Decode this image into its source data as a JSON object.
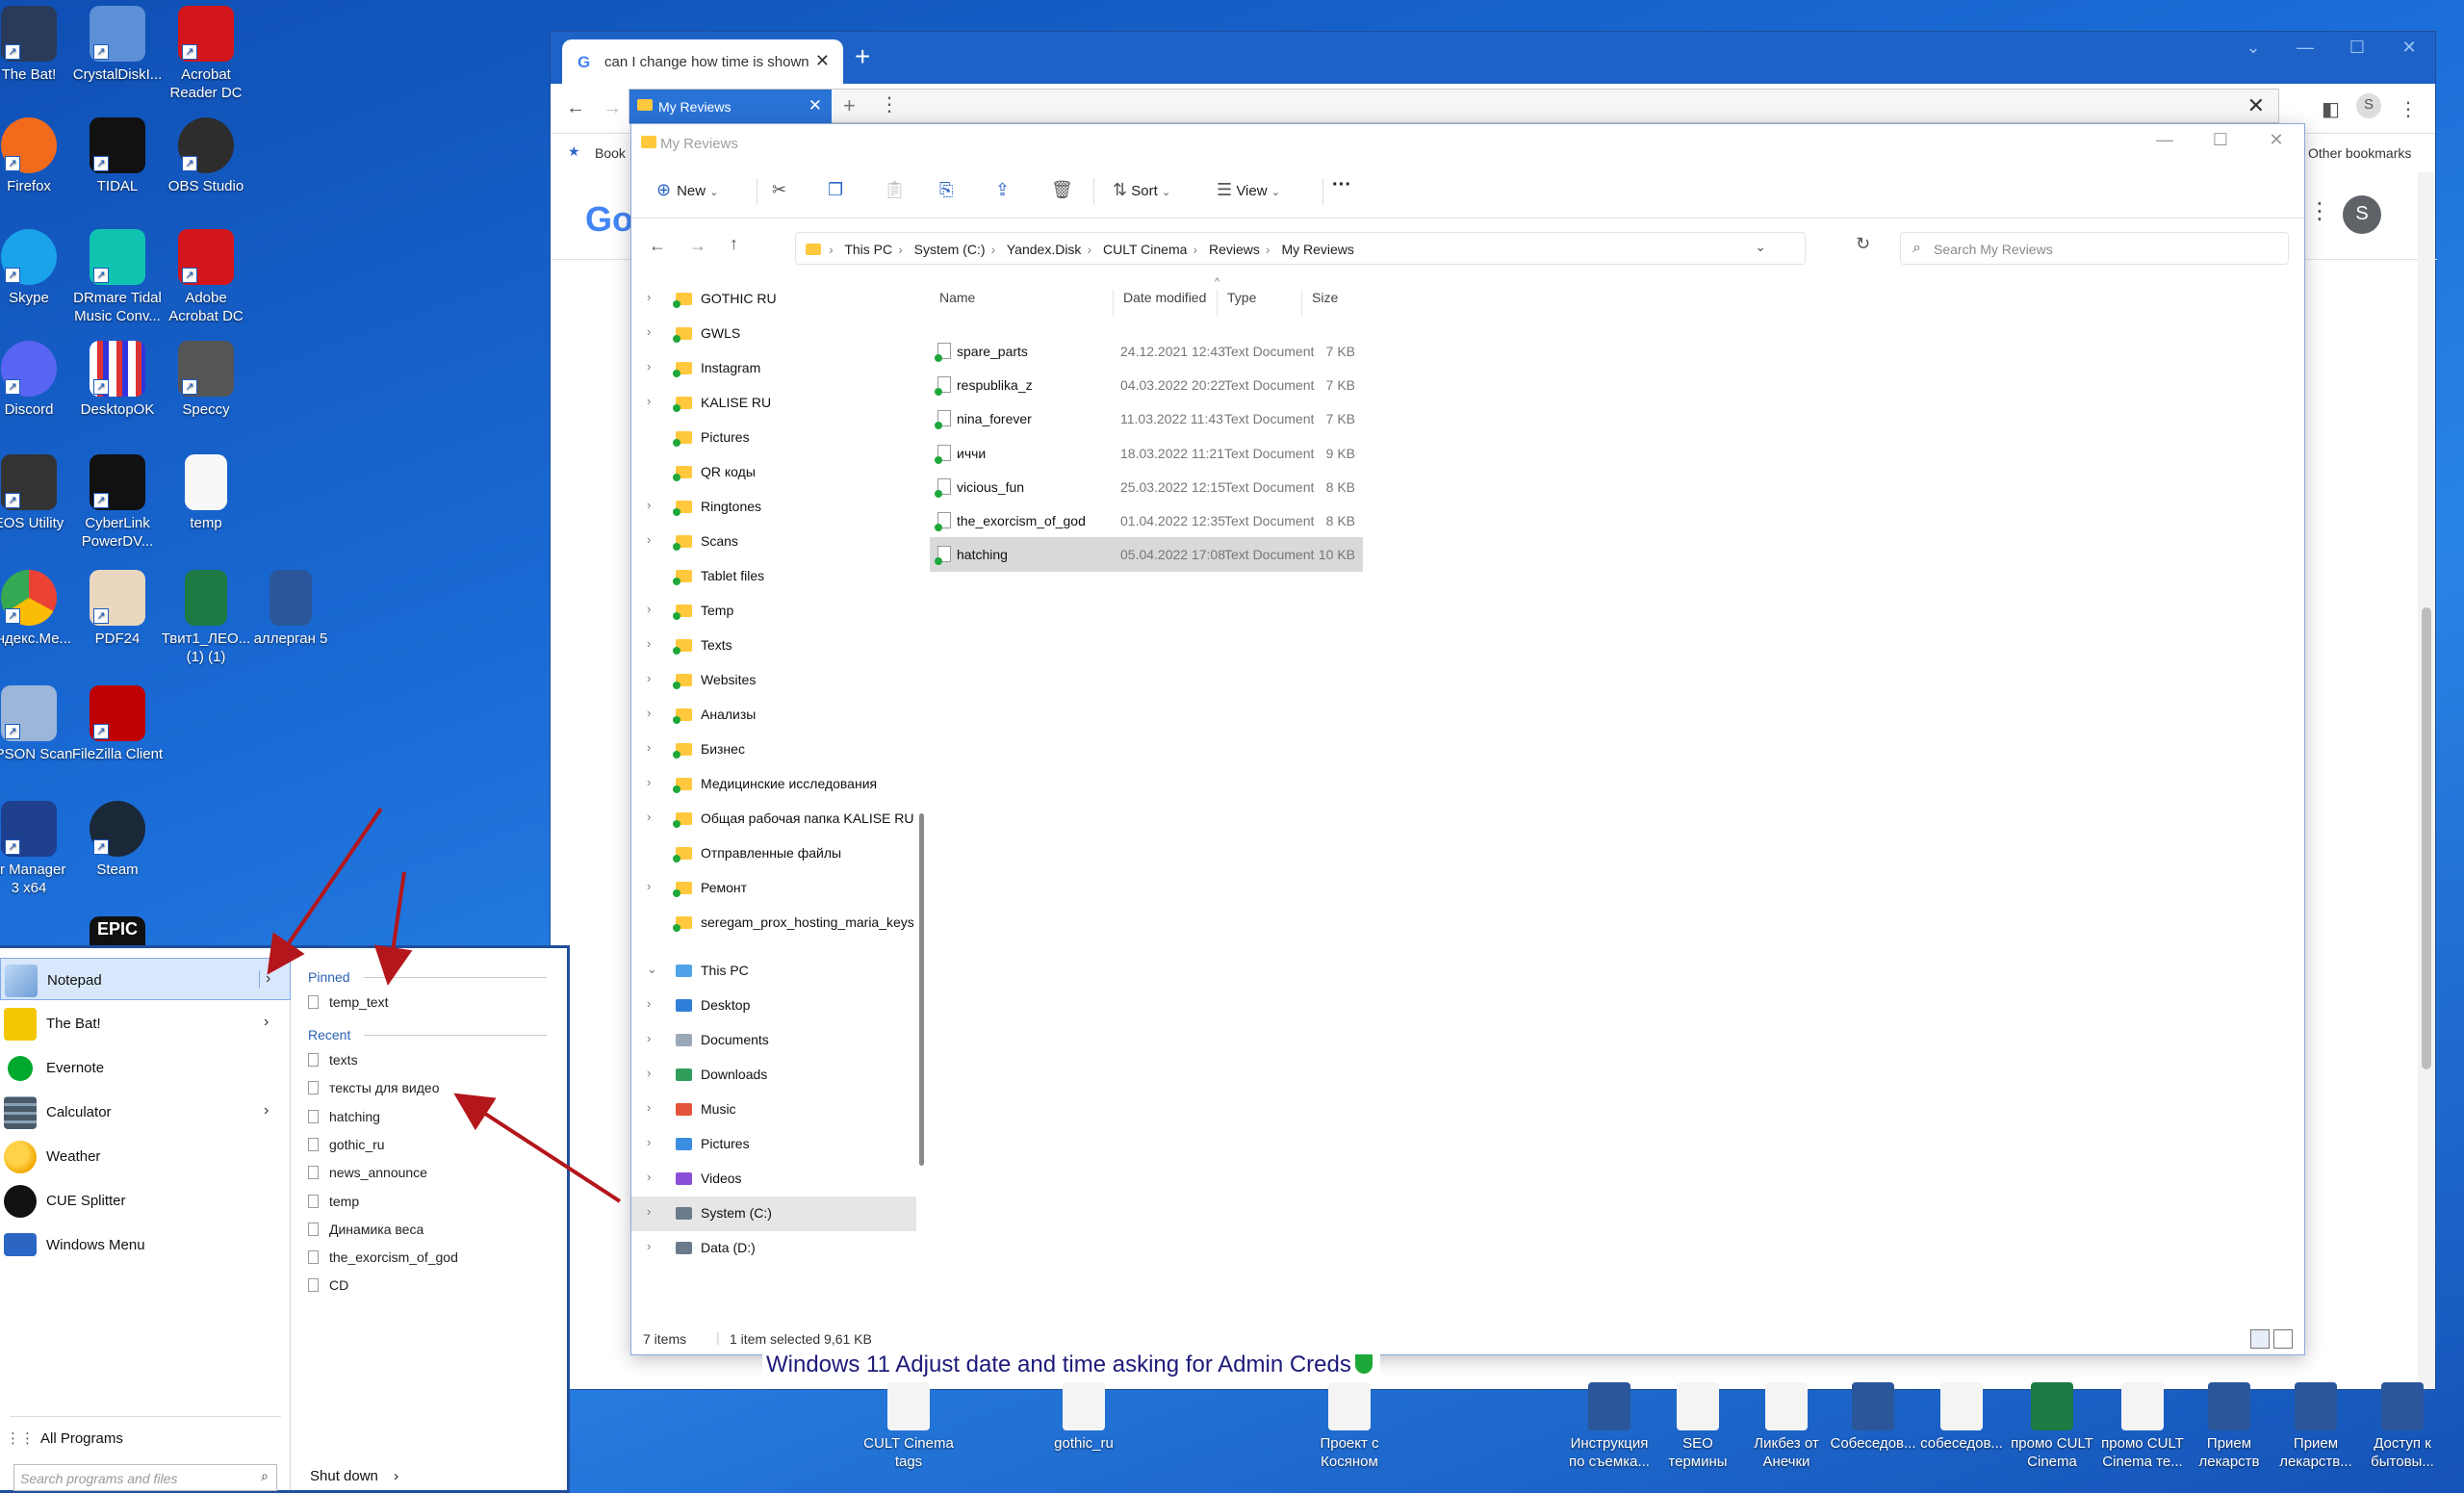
{
  "desktop_icons": [
    {
      "label": "The Bat!"
    },
    {
      "label": "CrystalDiskI..."
    },
    {
      "label": "Acrobat\nReader DC"
    },
    {
      "label": "Firefox"
    },
    {
      "label": "TIDAL"
    },
    {
      "label": "OBS Studio"
    },
    {
      "label": "Skype"
    },
    {
      "label": "DRmare Tidal\nMusic Conv..."
    },
    {
      "label": "Adobe\nAcrobat DC"
    },
    {
      "label": "Discord"
    },
    {
      "label": "DesktopOK"
    },
    {
      "label": "Speccy"
    },
    {
      "label": "EOS Utility"
    },
    {
      "label": "CyberLink\nPowerDV..."
    },
    {
      "label": "temp"
    },
    {
      "label": "Яндекс.Ме..."
    },
    {
      "label": "PDF24"
    },
    {
      "label": "Твит1_ЛЕО...\n(1) (1)"
    },
    {
      "label": "аллерган 5"
    },
    {
      "label": "EPSON Scan"
    },
    {
      "label": "FileZilla Client"
    },
    {
      "label": "ar Manager\n3 x64"
    },
    {
      "label": "Steam"
    },
    {
      "label": "EPIC"
    }
  ],
  "chrome": {
    "tab_title": "can I change how time is shown",
    "tab_close": "✕",
    "new_tab": "+",
    "bookmarks_partial": "Book",
    "other_bookmarks": "Other bookmarks",
    "profile_initial": "S",
    "google_partial": "Go"
  },
  "explorer_tab": {
    "label": "My Reviews",
    "close": "✕",
    "plus": "+"
  },
  "explorer": {
    "title": "My Reviews",
    "toolbar": {
      "new": "New",
      "sort": "Sort",
      "view": "View",
      "more": "···"
    },
    "breadcrumb": [
      "This PC",
      "System (C:)",
      "Yandex.Disk",
      "CULT Cinema",
      "Reviews",
      "My Reviews"
    ],
    "search_placeholder": "Search My Reviews",
    "columns": [
      "Name",
      "Date modified",
      "Type",
      "Size"
    ],
    "files": [
      {
        "name": "spare_parts",
        "date": "24.12.2021 12:43",
        "type": "Text Document",
        "size": "7 KB"
      },
      {
        "name": "respublika_z",
        "date": "04.03.2022 20:22",
        "type": "Text Document",
        "size": "7 KB"
      },
      {
        "name": "nina_forever",
        "date": "11.03.2022 11:43",
        "type": "Text Document",
        "size": "7 KB"
      },
      {
        "name": "иччи",
        "date": "18.03.2022 11:21",
        "type": "Text Document",
        "size": "9 KB"
      },
      {
        "name": "vicious_fun",
        "date": "25.03.2022 12:15",
        "type": "Text Document",
        "size": "8 KB"
      },
      {
        "name": "the_exorcism_of_god",
        "date": "01.04.2022 12:35",
        "type": "Text Document",
        "size": "8 KB"
      },
      {
        "name": "hatching",
        "date": "05.04.2022 17:08",
        "type": "Text Document",
        "size": "10 KB"
      }
    ],
    "nav": [
      {
        "label": "GOTHIC RU"
      },
      {
        "label": "GWLS"
      },
      {
        "label": "Instagram"
      },
      {
        "label": "KALISE RU"
      },
      {
        "label": "Pictures"
      },
      {
        "label": "QR коды"
      },
      {
        "label": "Ringtones"
      },
      {
        "label": "Scans"
      },
      {
        "label": "Tablet files"
      },
      {
        "label": "Temp"
      },
      {
        "label": "Texts"
      },
      {
        "label": "Websites"
      },
      {
        "label": "Анализы"
      },
      {
        "label": "Бизнес"
      },
      {
        "label": "Медицинские исследования"
      },
      {
        "label": "Общая рабочая папка KALISE RU"
      },
      {
        "label": "Отправленные файлы"
      },
      {
        "label": "Ремонт"
      },
      {
        "label": "seregam_prox_hosting_maria_keys"
      },
      {
        "label": "This PC"
      },
      {
        "label": "Desktop"
      },
      {
        "label": "Documents"
      },
      {
        "label": "Downloads"
      },
      {
        "label": "Music"
      },
      {
        "label": "Pictures"
      },
      {
        "label": "Videos"
      },
      {
        "label": "System (C:)"
      },
      {
        "label": "Data (D:)"
      }
    ],
    "status": {
      "items": "7 items",
      "selected": "1 item selected  9,61 KB"
    }
  },
  "start_menu": {
    "apps": [
      {
        "label": "Notepad"
      },
      {
        "label": "The Bat!"
      },
      {
        "label": "Evernote"
      },
      {
        "label": "Calculator"
      },
      {
        "label": "Weather"
      },
      {
        "label": "CUE Splitter"
      },
      {
        "label": "Windows Menu"
      }
    ],
    "pinned_header": "Pinned",
    "pinned": [
      "temp_text"
    ],
    "recent_header": "Recent",
    "recent": [
      "texts",
      "тексты для видео",
      "hatching",
      "gothic_ru",
      "news_announce",
      "temp",
      "Динамика веса",
      "the_exorcism_of_god",
      "CD"
    ],
    "all_programs": "All Programs",
    "search_placeholder": "Search programs and files",
    "shutdown": "Shut down"
  },
  "taskbar_icons": [
    {
      "label": "CULT Cinema\ntags"
    },
    {
      "label": "gothic_ru"
    },
    {
      "label": "Проект с\nКосяном"
    },
    {
      "label": "Инструкция\nпо съемка..."
    },
    {
      "label": "SEO\nтермины"
    },
    {
      "label": "Ликбез от\nАнечки"
    },
    {
      "label": "Собеседов..."
    },
    {
      "label": "собеседов..."
    },
    {
      "label": "промо CULT\nCinema"
    },
    {
      "label": "промо CULT\nCinema те..."
    },
    {
      "label": "Прием\nлекарств"
    },
    {
      "label": "Прием\nлекарств..."
    },
    {
      "label": "Доступ к\nбытовы..."
    }
  ],
  "caption": "Windows 11 Adjust date and time asking for Admin Creds",
  "colors": {
    "accent": "#1e62c8",
    "selection": "#d9d9d9",
    "arrow": "#b3161b"
  }
}
